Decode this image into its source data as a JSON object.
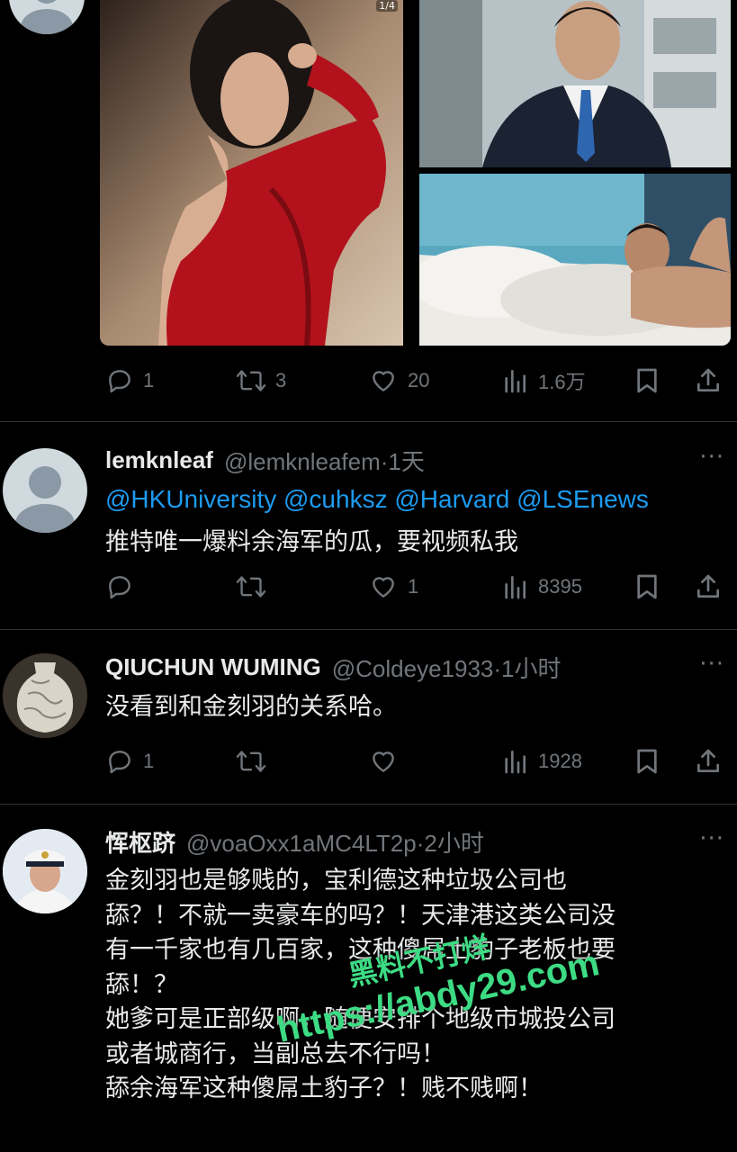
{
  "post1": {
    "image_counter": "1/4",
    "actions": {
      "replies": "1",
      "reposts": "3",
      "likes": "20",
      "views": "1.6万"
    }
  },
  "reply1": {
    "display_name": "lemknleaf",
    "handle_time": "@lemknleafem·1天",
    "mentions": "@HKUniversity @cuhksz @Harvard @LSEnews",
    "text": "推特唯一爆料余海军的瓜，要视频私我",
    "actions": {
      "replies": "",
      "reposts": "",
      "likes": "1",
      "views": "8395"
    }
  },
  "reply2": {
    "display_name": "QIUCHUN WUMING",
    "handle_time": "@Coldeye1933·1小时",
    "text": "没看到和金刻羽的关系哈。",
    "actions": {
      "replies": "1",
      "reposts": "",
      "likes": "",
      "views": "1928"
    }
  },
  "reply3": {
    "display_name": "恽枢跻",
    "handle_time": "@voaOxx1aMC4LT2p·2小时",
    "lines": [
      "金刻羽也是够贱的，宝利德这种垃圾公司也",
      "舔？！不就一卖豪车的吗？！天津港这类公司没",
      "有一千家也有几百家，这种傻屌土豹子老板也要",
      "舔！？",
      "她爹可是正部级啊，随便安排个地级市城投公司",
      "或者城商行，当副总去不行吗！",
      "舔余海军这种傻屌土豹子？！贱不贱啊！"
    ]
  },
  "more_label": "···",
  "watermark": {
    "line1": "黑料不打烊",
    "line2": "https://abdy29.com"
  },
  "colors": {
    "background": "#000000",
    "text": "#e7e9ea",
    "muted": "#71767b",
    "link": "#1d9bf0",
    "divider": "#2f3336"
  },
  "icons": [
    "reply-icon",
    "repost-icon",
    "like-icon",
    "views-icon",
    "bookmark-icon",
    "share-icon",
    "more-icon"
  ]
}
